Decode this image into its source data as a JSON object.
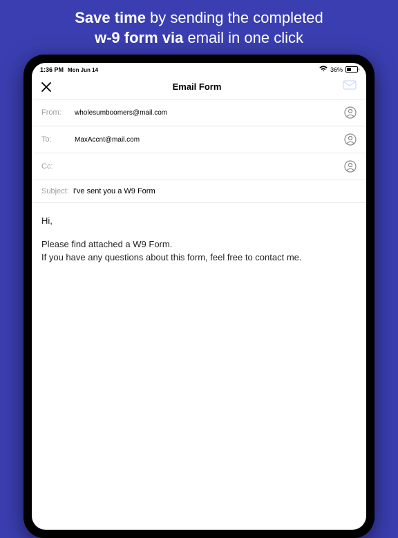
{
  "promo": {
    "line1_regular": " by sending the completed",
    "line1_bold": "Save time",
    "line2_bold": "w-9 form via",
    "line2_regular": " email in one click"
  },
  "statusbar": {
    "time": "1:36 PM",
    "date": "Mon Jun 14",
    "battery_pct": "36%"
  },
  "nav": {
    "title": "Email Form"
  },
  "fields": {
    "from_label": "From:",
    "from_value": "wholesumboomers@mail.com",
    "to_label": "To:",
    "to_value": "MaxAccnt@mail.com",
    "cc_label": "Cc:",
    "cc_value": ""
  },
  "subject": {
    "label": "Subject:",
    "value": "I've sent you a W9 Form"
  },
  "body": {
    "greeting": "Hi,",
    "p1": "Please find attached a W9 Form.",
    "p2": "If you have any questions about this form, feel free to contact me."
  }
}
